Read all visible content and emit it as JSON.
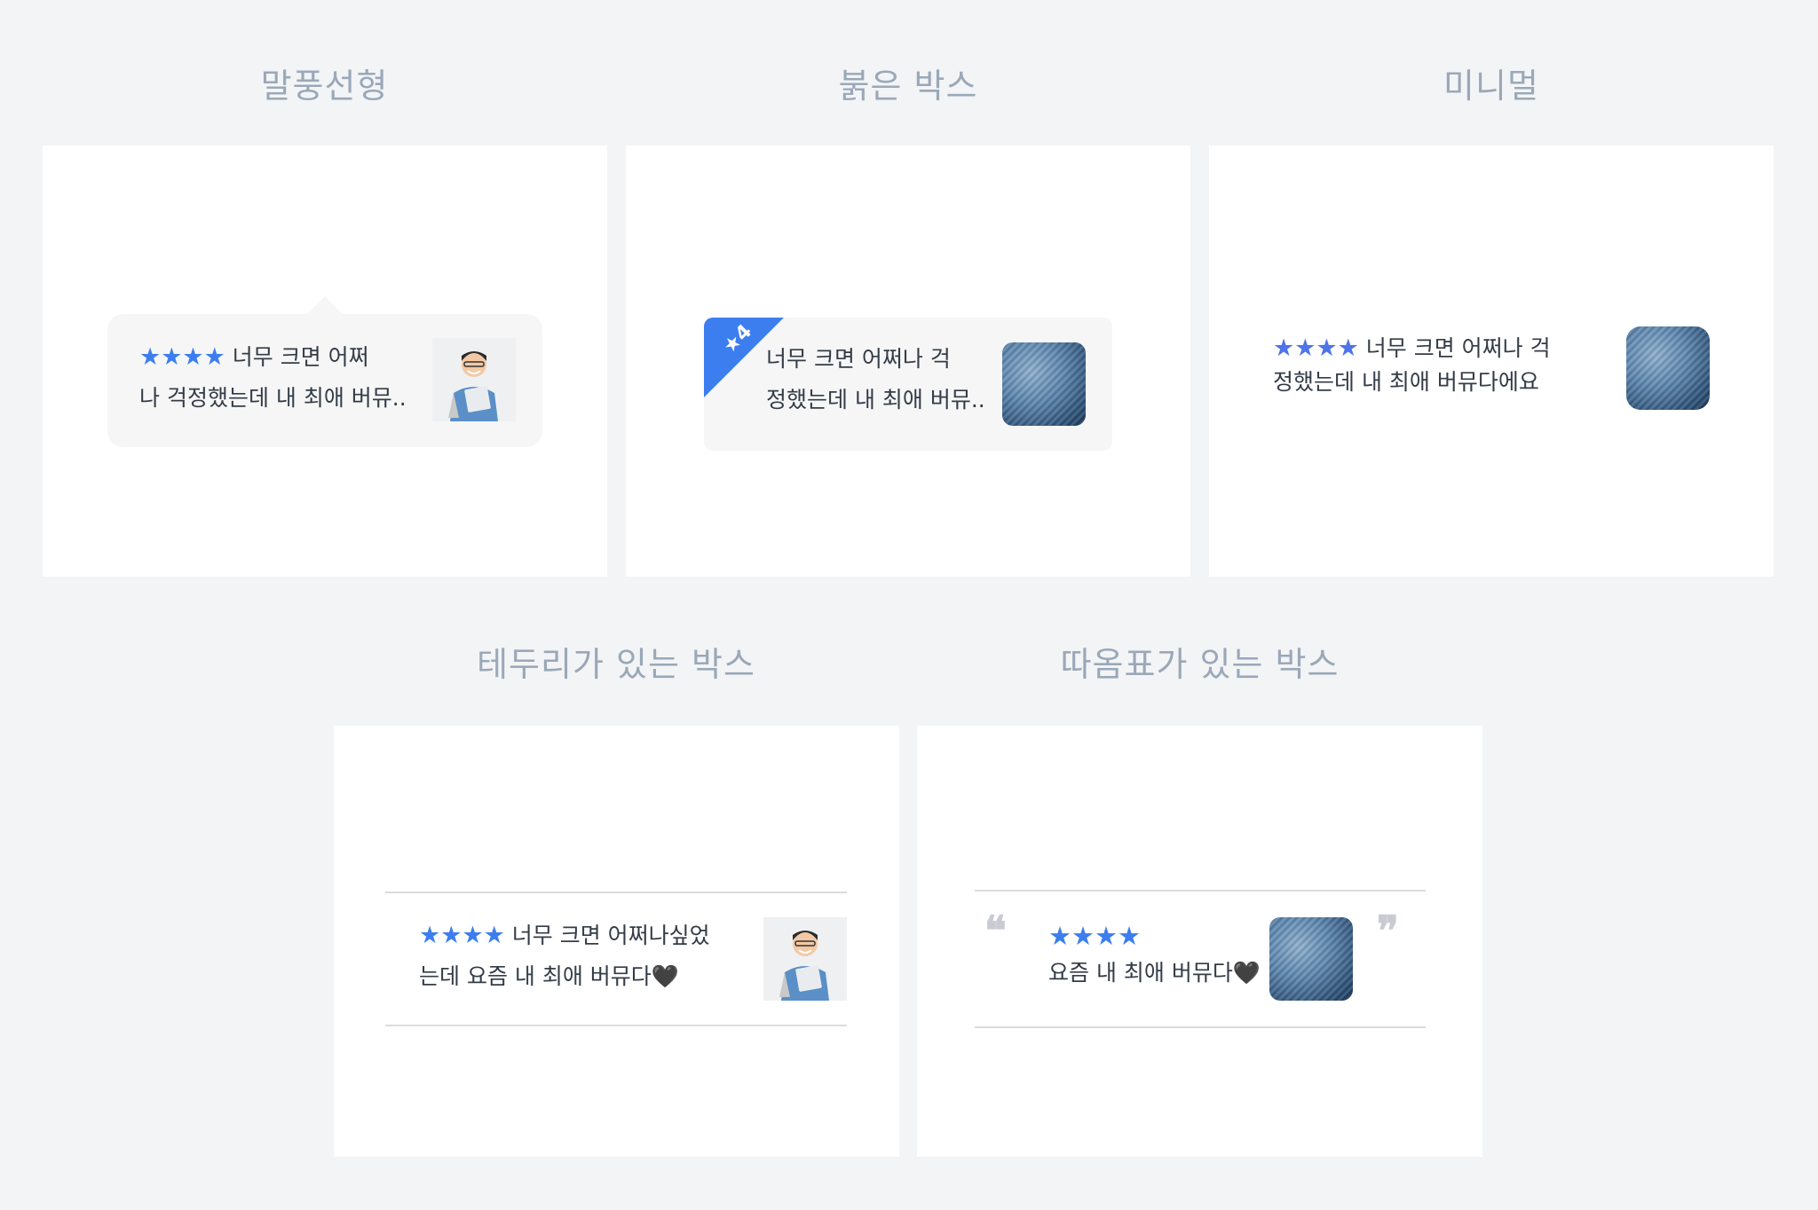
{
  "sections": {
    "speech_bubble": {
      "title": "말풍선형",
      "stars": "★★★★",
      "line1": "너무 크면 어쩌",
      "line2": "나 걱정했는데 내 최애 버뮤.."
    },
    "folded_box": {
      "title": "붉은 박스",
      "ribbon": "★4",
      "line1": "너무 크면 어쩌나 걱",
      "line2": "정했는데 내 최애 버뮤.."
    },
    "minimal": {
      "title": "미니멀",
      "stars": "★★★★",
      "line1": "너무 크면 어쩌나 걱",
      "line2": "정했는데 내 최애 버뮤다에요"
    },
    "bordered_box": {
      "title": "테두리가 있는 박스",
      "stars": "★★★★",
      "line1": "너무 크면 어쩌나싶었",
      "line2": "는데 요즘 내 최애 버뮤다🖤"
    },
    "quote_box": {
      "title": "따옴표가 있는 박스",
      "stars": "★★★★",
      "line1": "요즘 내 최애 버뮤다🖤",
      "open_quote": "❝",
      "close_quote": "❞"
    }
  },
  "colors": {
    "star": "#3c7ef0",
    "title": "#9aa8b8",
    "background": "#f3f4f6"
  },
  "icons": {
    "person_photo": "person-photo",
    "knit_photo": "knit-fabric-photo"
  }
}
